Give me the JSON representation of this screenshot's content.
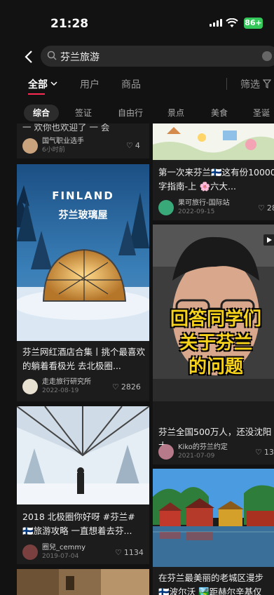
{
  "status": {
    "time": "21:28",
    "battery": "86+"
  },
  "search": {
    "query": "芬兰旅游"
  },
  "tabs": [
    "全部",
    "用户",
    "商品"
  ],
  "filter_label": "筛选",
  "chips": [
    "综合",
    "签证",
    "自由行",
    "景点",
    "美食",
    "圣诞"
  ],
  "cards": {
    "c0": {
      "title": "一  欢你也欢迎了  一  会",
      "author": "国气职业选手",
      "date": "6小时前",
      "likes": "4"
    },
    "c1": {
      "title": "芬兰网红酒店合集丨挑个最喜欢的躺着看极光 去北极圈...",
      "author": "走走旅行研究所",
      "date": "2022-08-19",
      "likes": "2826",
      "overlay_big": "FINLAND",
      "overlay_small": "芬兰玻璃屋"
    },
    "c2": {
      "title": "2018 北极圈你好呀 #芬兰# 🇫🇮旅游攻略 一直想着去芬...",
      "author": "圈兒_cemmy",
      "date": "2019-07-04",
      "likes": "1134"
    },
    "c4": {
      "title": "第一次来芬兰🇫🇮这有份10000字指南-上 🌸六大...",
      "author": "果可旅行-国际站",
      "date": "2022-09-15",
      "likes": "28"
    },
    "c5": {
      "title": "芬兰全国500万人，还没沈阳大",
      "author": "Kiko的芬兰约定",
      "date": "2021-07-09",
      "likes": "13",
      "caption": [
        "回答同学们",
        "关于芬兰",
        "的问题"
      ]
    },
    "c6": {
      "title": "在芬兰最美丽的老城区漫步",
      "title2": "🇫🇮波尔沃 🏞️距赫尔辛基仅"
    }
  },
  "colors": {
    "accent": "#ff2a54",
    "bg": "#121212",
    "card": "#1c1c1c"
  }
}
